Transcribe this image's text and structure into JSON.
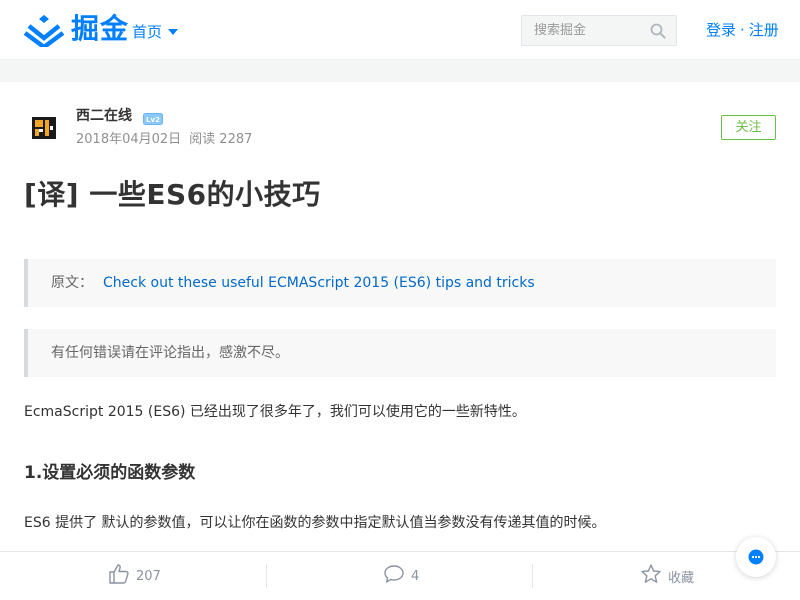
{
  "nav": {
    "brand": "掘金",
    "home_menu": "首页",
    "search_placeholder": "搜索掘金",
    "login": "登录",
    "separator": "·",
    "register": "注册"
  },
  "author": {
    "name": "西二在线",
    "level_badge": "Lv2",
    "date": "2018年04月02日",
    "reads": "阅读 2287",
    "follow_label": "关注"
  },
  "article": {
    "title": "[译] 一些ES6的小技巧",
    "original_prefix": "原文：",
    "original_link": "Check out these useful ECMAScript 2015 (ES6) tips and tricks",
    "note": "有任何错误请在评论指出，感激不尽。",
    "intro": "EcmaScript 2015 (ES6) 已经出现了很多年了，我们可以使用它的一些新特性。",
    "section1_heading": "1.设置必须的函数参数",
    "section1_text": "ES6 提供了 默认的参数值，可以让你在函数的参数中指定默认值当参数没有传递其值的时候。"
  },
  "actions": {
    "likes": "207",
    "comments": "4",
    "collect_label": "收藏"
  },
  "colors": {
    "accent": "#007fff",
    "follow_green": "#6cbd45",
    "link": "#0269c8"
  }
}
